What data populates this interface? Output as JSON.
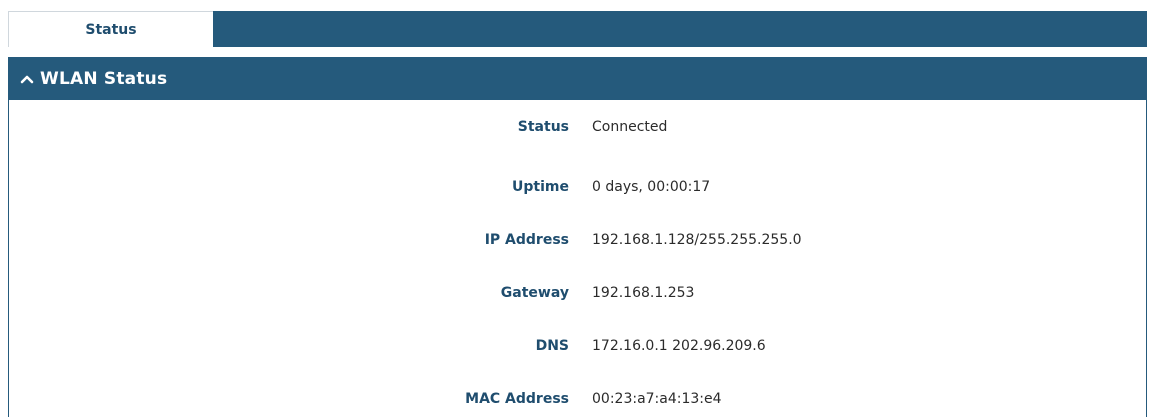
{
  "tabs": [
    {
      "label": "Status",
      "active": true
    }
  ],
  "panel": {
    "title": "WLAN Status",
    "collapse_icon": "chevron-up-icon",
    "rows": [
      {
        "label": "Status",
        "value": "Connected"
      },
      {
        "label": "Uptime",
        "value": "0 days, 00:00:17"
      },
      {
        "label": "IP Address",
        "value": "192.168.1.128/255.255.255.0"
      },
      {
        "label": "Gateway",
        "value": "192.168.1.253"
      },
      {
        "label": "DNS",
        "value": "172.16.0.1 202.96.209.6"
      },
      {
        "label": "MAC Address",
        "value": "00:23:a7:a4:13:e4"
      }
    ]
  },
  "colors": {
    "header_bg": "#255a7c",
    "label_text": "#1f4d6e",
    "value_text": "#2b2b2b"
  }
}
